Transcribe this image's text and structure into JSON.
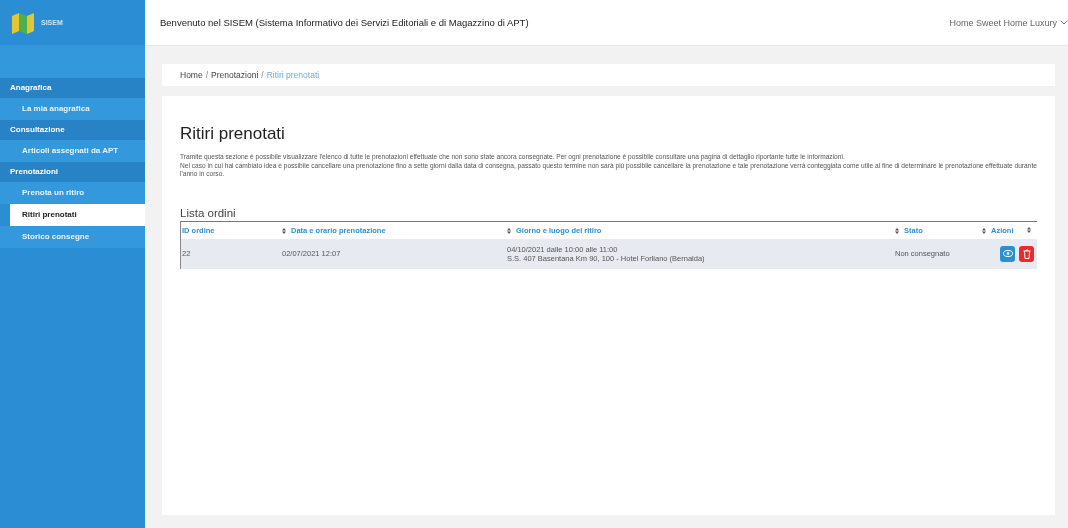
{
  "app": {
    "logo": "SISEM"
  },
  "header": {
    "title": "Benvenuto nel SISEM (Sistema Informativo dei Servizi Editoriali e di Magazzino di APT)",
    "user": "Home Sweet Home Luxury"
  },
  "sidebar": {
    "sections": [
      {
        "title": "Anagrafica",
        "items": [
          {
            "label": "La mia anagrafica",
            "selected": false
          }
        ]
      },
      {
        "title": "Consultazione",
        "items": [
          {
            "label": "Articoli assegnati da APT",
            "selected": false
          }
        ]
      },
      {
        "title": "Prenotazioni",
        "items": [
          {
            "label": "Prenota un ritiro",
            "selected": false
          },
          {
            "label": "Ritiri prenotati",
            "selected": true
          },
          {
            "label": "Storico consegne",
            "selected": false
          }
        ]
      }
    ]
  },
  "breadcrumb": {
    "separator": "/",
    "links": [
      "Home",
      "Prenotazioni"
    ],
    "current": "Ritiri prenotati"
  },
  "page": {
    "title": "Ritiri prenotati",
    "description": "Tramite questa sezione è possibile visualizzare l'elenco di tutte le prenotazioni effettuate che non sono state ancora consegnate. Per ogni prenotazione è possibile consultare una pagina di dettaglio riportante tutte le informazioni.\nNel caso in cui hai cambiato idea è possibile cancellare una prenotazione fino a sette giorni dalla data di consegna, passato questo termine non sarà più possibile cancellare la prenotazione e tale prenotazione verrà conteggiata come utile al fine di determinare le prenotazione effettuate durante l'anno in corso."
  },
  "table": {
    "title": "Lista ordini",
    "columns": [
      {
        "label": "ID ordine",
        "sortable": false
      },
      {
        "label": "Data e orario prenotazione",
        "sortable": true
      },
      {
        "label": "Giorno e luogo del ritiro",
        "sortable": true
      },
      {
        "label": "Stato",
        "sortable": true
      },
      {
        "label": "Azioni",
        "sortable": true
      }
    ],
    "rows": [
      {
        "id": "22",
        "booked": "02/07/2021 12:07",
        "pickup": [
          "04/10/2021 dalle 10:00 alle 11:00",
          "S.S. 407 Basentana Km 90, 100 - Hotel Forliano (Bernalda)"
        ],
        "status": "Non consegnato"
      }
    ]
  }
}
